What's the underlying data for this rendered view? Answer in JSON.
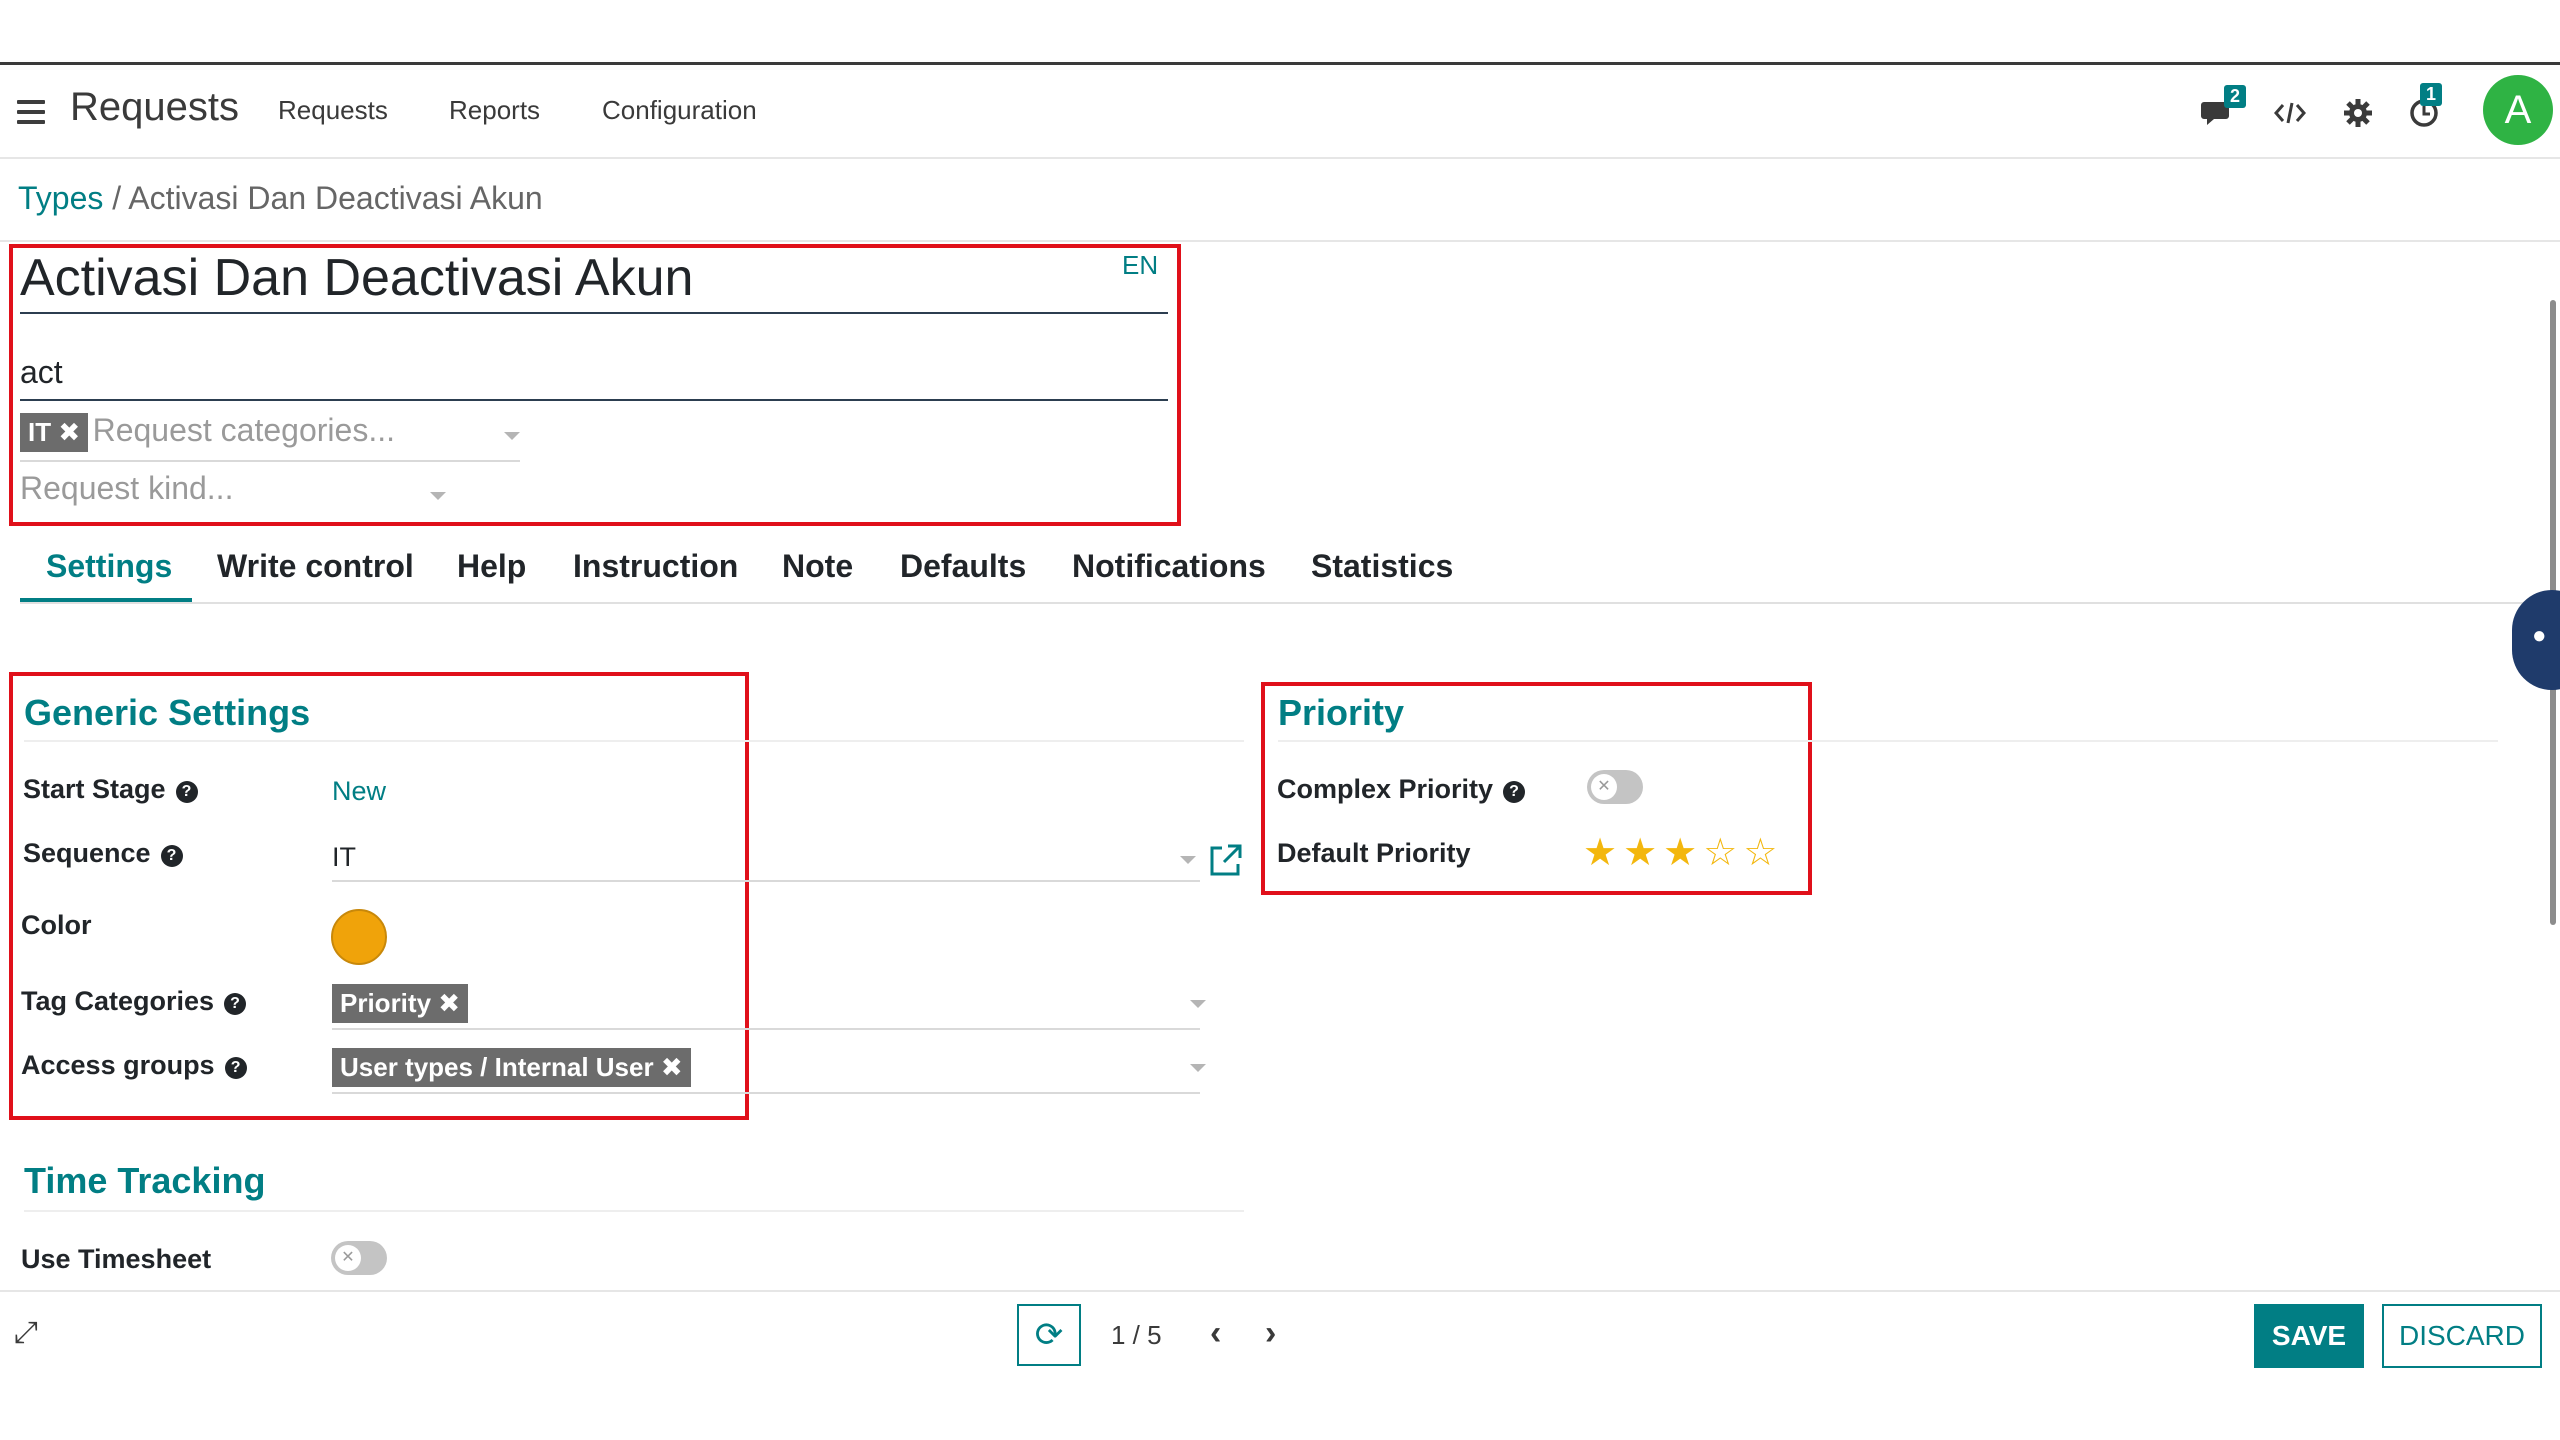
{
  "navbar": {
    "app_title": "Requests",
    "menu": [
      "Requests",
      "Reports",
      "Configuration"
    ],
    "messages_badge": "2",
    "activity_badge": "1",
    "avatar_letter": "A",
    "icons": [
      "hamburger-icon",
      "chat-icon",
      "code-icon",
      "gear-icon",
      "clock-icon"
    ]
  },
  "breadcrumb": {
    "parent": "Types",
    "separator": " / ",
    "current": "Activasi Dan Deactivasi Akun"
  },
  "header": {
    "name": "Activasi Dan Deactivasi Akun",
    "lang": "EN",
    "code": "act",
    "category_tag": "IT",
    "categories_placeholder": "Request categories...",
    "kind_placeholder": "Request kind..."
  },
  "tabs": [
    "Settings",
    "Write control",
    "Help",
    "Instruction",
    "Note",
    "Defaults",
    "Notifications",
    "Statistics"
  ],
  "active_tab": "Settings",
  "generic": {
    "title": "Generic Settings",
    "start_stage_label": "Start Stage",
    "start_stage_value": "New",
    "sequence_label": "Sequence",
    "sequence_value": "IT",
    "color_label": "Color",
    "color_value": "#f0a30a",
    "tag_categories_label": "Tag Categories",
    "tag_categories_value": "Priority",
    "access_groups_label": "Access groups",
    "access_groups_value": "User types / Internal User"
  },
  "priority": {
    "title": "Priority",
    "complex_label": "Complex Priority",
    "complex_enabled": false,
    "default_label": "Default Priority",
    "default_stars": 3,
    "max_stars": 5
  },
  "time_tracking": {
    "title": "Time Tracking",
    "use_timesheet_label": "Use Timesheet",
    "use_timesheet_enabled": false
  },
  "footer": {
    "pager": "1 / 5",
    "save_label": "SAVE",
    "discard_label": "DISCARD"
  },
  "colors": {
    "accent": "#017e84",
    "highlight_box": "#e0101a",
    "star": "#f3b70e",
    "avatar": "#2fb344"
  }
}
